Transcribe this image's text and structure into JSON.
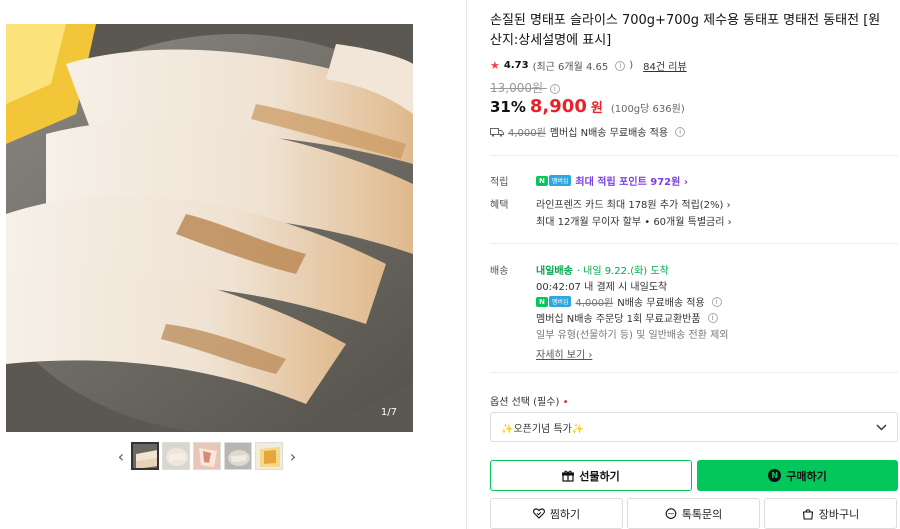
{
  "gallery": {
    "counter": "1/7",
    "prev_icon": "‹",
    "next_icon": "›"
  },
  "product": {
    "title": "손질된 명태포 슬라이스 700g+700g 제수용 동태포 명태전 동태전 [원산지:상세설명에 표시]",
    "rating": "4.73",
    "rating_recent": "(최근 6개월 4.65",
    "review_count": "84건 리뷰",
    "original_price": "13,000원",
    "discount": "31%",
    "price": "8,900",
    "price_unit": "원",
    "unit_price": "(100g당 636원)",
    "ship_orig": "4,000원",
    "ship_text": "멤버십 N배송 무료배송 적용"
  },
  "points": {
    "label": "적립",
    "badge_n": "N",
    "badge_m": "멤버십",
    "text": "최대 적립 포인트 972원 ›"
  },
  "benefits": {
    "label": "혜택",
    "line1": "라인프렌즈 카드 최대 178원 추가 적립(2%) ›",
    "line2": "최대 12개월 무이자 할부 • 60개월 특별금리 ›"
  },
  "delivery": {
    "label": "배송",
    "badge": "내일배송",
    "date": "· 내일 9.22.(화) 도착",
    "countdown": "00:42:07  내 결제 시 내일도착",
    "ship_orig": "4,000원",
    "ship_text": "N배송 무료배송 적용",
    "exchange": "멤버십 N배송 주문당 1회 무료교환반품",
    "note": "일부 유형(선물하기 등) 및 일반배송 전환 제외",
    "more": "자세히 보기 ›"
  },
  "option": {
    "label": "옵션 선택 (필수)",
    "required_mark": "•",
    "selected": "✨오픈기념 특가✨"
  },
  "buttons": {
    "gift": "선물하기",
    "buy": "구매하기",
    "wish": "찜하기",
    "talk": "톡톡문의",
    "cart": "장바구니"
  },
  "colors": {
    "accent_green": "#03c75a",
    "price_red": "#e8212a",
    "point_purple": "#7b3fe4"
  }
}
